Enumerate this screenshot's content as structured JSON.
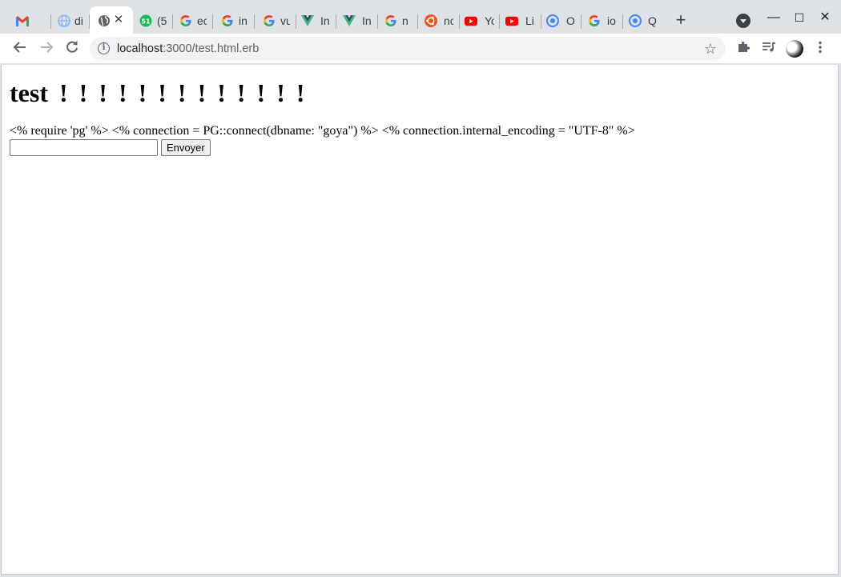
{
  "browser": {
    "tabs": [
      {
        "title": "",
        "icon": "gmail-icon",
        "color": "#EA4335"
      },
      {
        "title": "di",
        "icon": "globe-blue-icon",
        "color": "#8ab4f8"
      },
      {
        "title": "",
        "icon": "globe-icon",
        "color": "#3c4043",
        "active": true
      },
      {
        "title": "(5",
        "icon": "badge-51-icon",
        "color": "#1db954"
      },
      {
        "title": "ec",
        "icon": "google-icon",
        "color": "#4285F4"
      },
      {
        "title": "in",
        "icon": "google-icon",
        "color": "#4285F4"
      },
      {
        "title": "vu",
        "icon": "google-icon",
        "color": "#4285F4"
      },
      {
        "title": "In",
        "icon": "vue-icon",
        "color": "#41b883"
      },
      {
        "title": "In",
        "icon": "vue-icon",
        "color": "#41b883"
      },
      {
        "title": "n",
        "icon": "google-icon",
        "color": "#4285F4"
      },
      {
        "title": "nc",
        "icon": "ubuntu-icon",
        "color": "#E95420"
      },
      {
        "title": "Yo",
        "icon": "youtube-icon",
        "color": "#FF0000"
      },
      {
        "title": "Li",
        "icon": "youtube-icon",
        "color": "#FF0000"
      },
      {
        "title": "O",
        "icon": "chromium-icon",
        "color": "#4285F4"
      },
      {
        "title": "io",
        "icon": "google-icon",
        "color": "#4285F4"
      },
      {
        "title": "Q",
        "icon": "chromium-icon",
        "color": "#4285F4"
      }
    ],
    "address": {
      "host": "localhost",
      "path": ":3000/test.html.erb"
    }
  },
  "page": {
    "heading": "test ! ! ! ! ! ! ! ! ! ! ! ! !",
    "code_line": "<% require 'pg' %> <% connection = PG::connect(dbname: \"goya\") %> <% connection.internal_encoding = \"UTF-8\" %>",
    "input_value": "",
    "submit_label": "Envoyer"
  }
}
